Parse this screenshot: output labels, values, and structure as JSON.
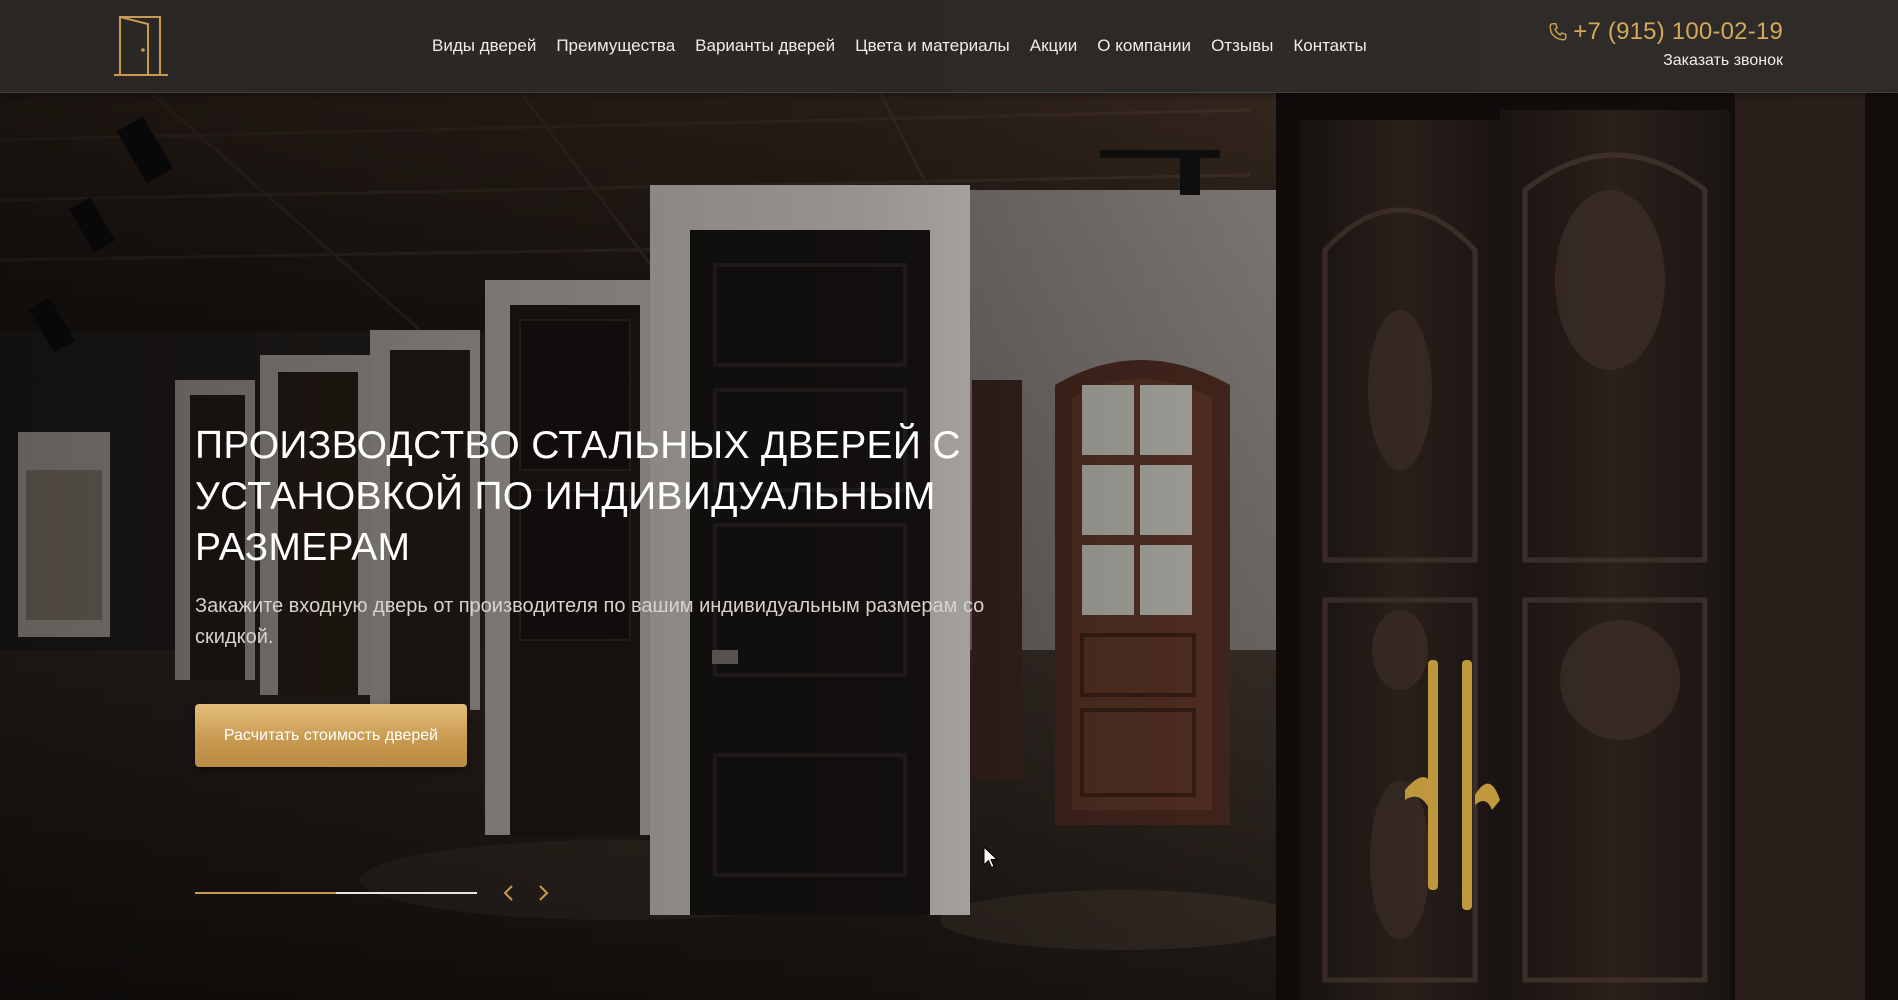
{
  "header": {
    "logo_icon": "door-logo-icon",
    "nav": [
      {
        "label": "Виды дверей"
      },
      {
        "label": "Преимущества"
      },
      {
        "label": "Варианты дверей"
      },
      {
        "label": "Цвета и материалы"
      },
      {
        "label": "Акции"
      },
      {
        "label": "О компании"
      },
      {
        "label": "Отзывы"
      },
      {
        "label": "Контакты"
      }
    ],
    "phone": "+7 (915) 100-02-19",
    "phone_icon": "phone-icon",
    "callback_label": "Заказать звонок"
  },
  "hero": {
    "title_lines": [
      "ПРОИЗВОДСТВО СТАЛЬНЫХ ДВЕРЕЙ С",
      "УСТАНОВКОЙ ПО ИНДИВИДУАЛЬНЫМ",
      "РАЗМЕРАМ"
    ],
    "subtitle": "Закажите входную дверь от производителя по вашим индивидуальным размерам со скидкой.",
    "cta_label": "Расчитать стоимость дверей",
    "slider_progress": 0.5,
    "prev_icon": "chevron-left-icon",
    "next_icon": "chevron-right-icon"
  },
  "colors": {
    "accent": "#c99b52",
    "header_bg": "#2d2a28",
    "text_light": "#f1ece6"
  }
}
